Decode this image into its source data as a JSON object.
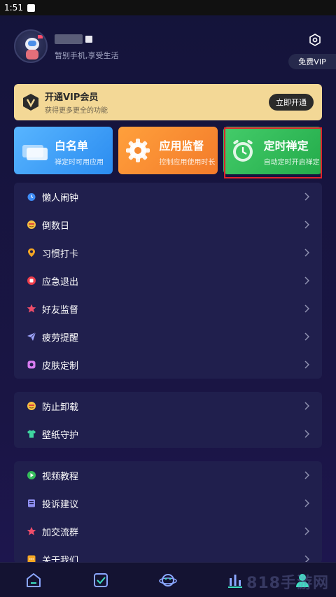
{
  "status_bar": {
    "time": "1:51"
  },
  "profile": {
    "slogan": "暂别手机,享受生活"
  },
  "header": {
    "vip_label": "免费VIP"
  },
  "vip_card": {
    "title": "开通VIP会员",
    "subtitle": "获得更多更全的功能",
    "button_label": "立即开通"
  },
  "features": [
    {
      "title": "白名单",
      "subtitle": "禅定时可用应用",
      "color": "#3fa2fb"
    },
    {
      "title": "应用监督",
      "subtitle": "控制应用使用时长",
      "color": "#f98e33"
    },
    {
      "title": "定时禅定",
      "subtitle": "自动定时开启禅定",
      "color": "#35bd5b"
    }
  ],
  "menu_group_1": [
    {
      "label": "懒人闹钟",
      "icon": "alarm-clock-icon"
    },
    {
      "label": "倒数日",
      "icon": "countdown-icon"
    },
    {
      "label": "习惯打卡",
      "icon": "location-pin-icon"
    },
    {
      "label": "应急退出",
      "icon": "stop-circle-icon"
    },
    {
      "label": "好友监督",
      "icon": "star-icon"
    },
    {
      "label": "疲劳提醒",
      "icon": "paper-plane-icon"
    },
    {
      "label": "皮肤定制",
      "icon": "skin-icon"
    }
  ],
  "menu_group_2": [
    {
      "label": "防止卸载",
      "icon": "smile-icon"
    },
    {
      "label": "壁纸守护",
      "icon": "shirt-icon"
    }
  ],
  "menu_group_3": [
    {
      "label": "视频教程",
      "icon": "play-icon"
    },
    {
      "label": "投诉建议",
      "icon": "document-icon"
    },
    {
      "label": "加交流群",
      "icon": "star-icon"
    },
    {
      "label": "关于我们",
      "icon": "info-icon"
    }
  ],
  "bottom_nav": [
    "home-icon",
    "checkbox-icon",
    "planet-icon",
    "stats-icon",
    "profile-icon"
  ],
  "watermark": "818手游网"
}
